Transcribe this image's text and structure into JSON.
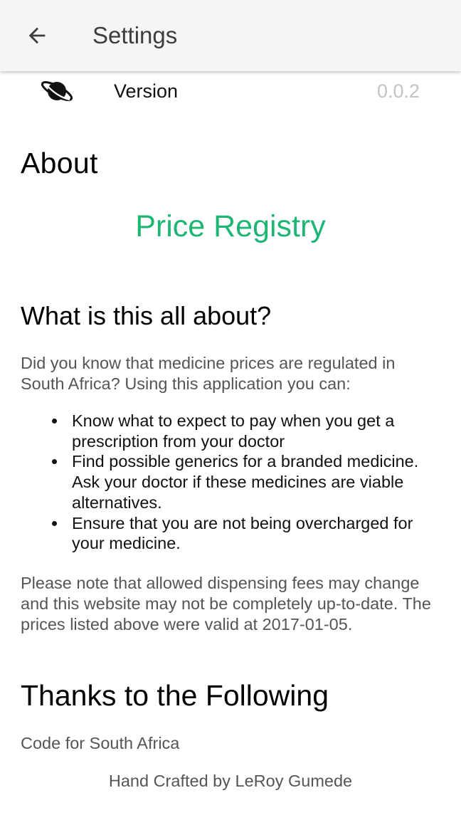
{
  "appbar": {
    "title": "Settings",
    "back_icon": "arrow-back-icon"
  },
  "version": {
    "icon": "planet-icon",
    "label": "Version",
    "value": "0.0.2"
  },
  "about": {
    "heading": "About",
    "app_name": "Price Registry",
    "app_name_color": "#1fb574"
  },
  "what": {
    "heading": "What is this all about?",
    "intro": "Did you know that medicine prices are regulated in South Africa? Using this application you can:",
    "bullets": [
      "Know what to expect to pay when you get a prescription from your doctor",
      "Find possible generics for a branded medicine. Ask your doctor if these medicines are viable alternatives.",
      "Ensure that you are not being overcharged for your medicine."
    ],
    "note": "Please note that allowed dispensing fees may change and this website may not be completely up-to-date. The prices listed above were valid at 2017-01-05."
  },
  "thanks": {
    "heading": "Thanks to the Following",
    "credits": [
      "Code for South Africa"
    ]
  },
  "footer": {
    "text": "Hand Crafted by LeRoy Gumede"
  }
}
